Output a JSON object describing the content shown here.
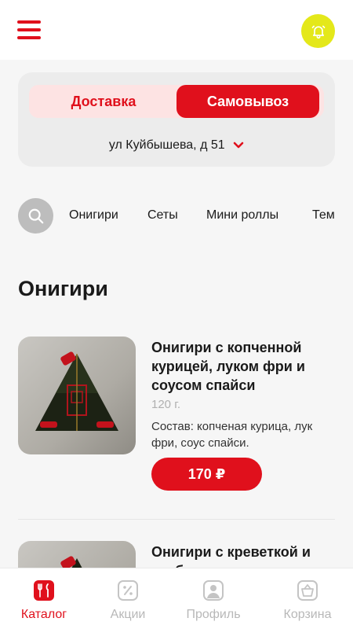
{
  "header": {
    "menu_icon": "hamburger-menu-icon",
    "notifications_icon": "bell-icon",
    "colors": {
      "accent": "#e0101c",
      "bell_bg": "#e4e81a"
    }
  },
  "delivery": {
    "delivery_label": "Доставка",
    "pickup_label": "Самовывоз",
    "selected_mode": "pickup",
    "address": "ул Куйбышева, д 51"
  },
  "categories": {
    "search_icon": "search-icon",
    "items": [
      "Онигири",
      "Сеты",
      "Мини роллы",
      "Тем"
    ]
  },
  "section": {
    "title": "Онигири"
  },
  "products": [
    {
      "name": "Онигири с копченной курицей, луком фри и соусом спайси",
      "weight": "120 г.",
      "composition": "Состав: копченая курица, лук фри, соус спайси.",
      "price": "170 ₽"
    },
    {
      "name": "Онигири с креветкой и краб-кремом"
    }
  ],
  "bottom_nav": [
    {
      "label": "Каталог",
      "icon": "catalog-icon",
      "active": true
    },
    {
      "label": "Акции",
      "icon": "discount-icon",
      "active": false
    },
    {
      "label": "Профиль",
      "icon": "profile-icon",
      "active": false
    },
    {
      "label": "Корзина",
      "icon": "basket-icon",
      "active": false
    }
  ]
}
